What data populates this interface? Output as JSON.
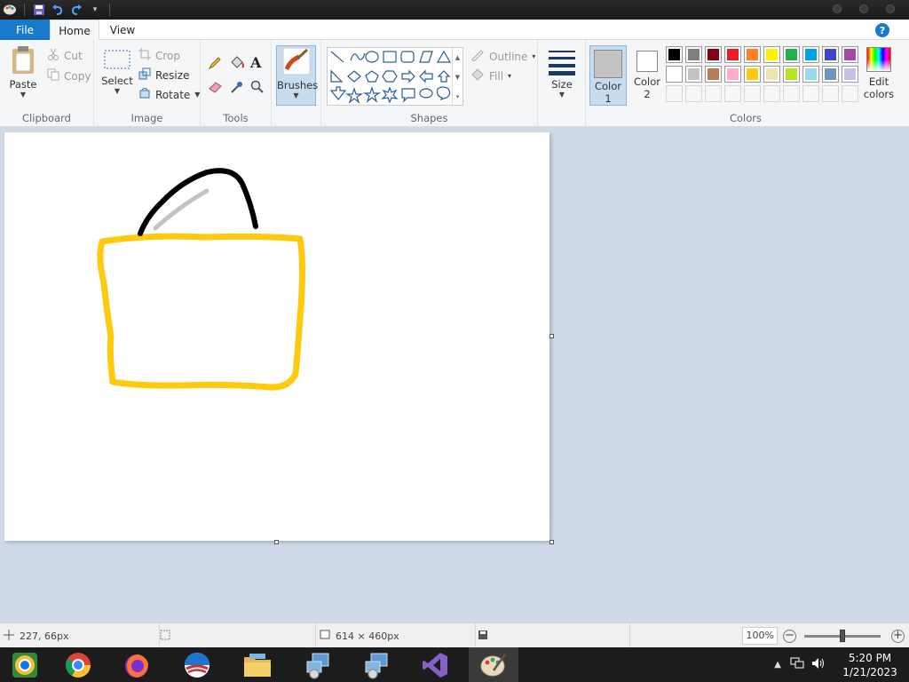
{
  "ribbon_tabs": {
    "file": "File",
    "home": "Home",
    "view": "View"
  },
  "clipboard": {
    "paste": "Paste",
    "cut": "Cut",
    "copy": "Copy",
    "label": "Clipboard"
  },
  "image": {
    "select": "Select",
    "crop": "Crop",
    "resize": "Resize",
    "rotate": "Rotate",
    "label": "Image"
  },
  "tools": {
    "label": "Tools"
  },
  "brushes": {
    "label": "Brushes"
  },
  "shapes": {
    "outline": "Outline",
    "fill": "Fill",
    "label": "Shapes"
  },
  "size": {
    "label": "Size"
  },
  "color1": {
    "label": "Color",
    "num": "1",
    "value": "#c3c3c3"
  },
  "color2": {
    "label": "Color",
    "num": "2",
    "value": "#ffffff"
  },
  "colors": {
    "label": "Colors",
    "edit_label": "Edit",
    "edit_label2": "colors",
    "palette_row1": [
      "#000000",
      "#7f7f7f",
      "#880015",
      "#ed1c24",
      "#ff7f27",
      "#fff200",
      "#22b14c",
      "#00a2e8",
      "#3f48cc",
      "#a349a4"
    ],
    "palette_row2": [
      "#ffffff",
      "#c3c3c3",
      "#b97a57",
      "#ffaec9",
      "#ffc90e",
      "#efe4b0",
      "#b5e61d",
      "#99d9ea",
      "#7092be",
      "#c8bfe7"
    ]
  },
  "status": {
    "cursor_pos": "227, 66px",
    "canvas_size": "614 × 460px",
    "zoom": "100%",
    "zoom_level": 0.5
  },
  "clock": {
    "time": "5:20 PM",
    "date": "1/21/2023"
  }
}
